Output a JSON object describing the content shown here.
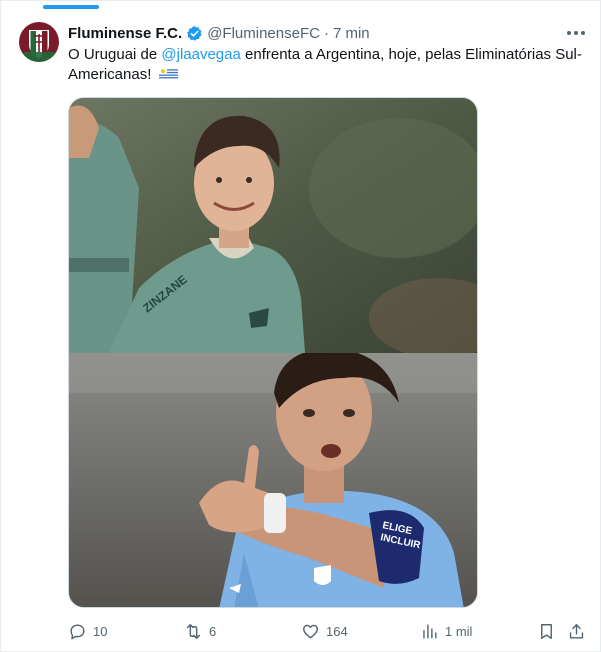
{
  "tweet": {
    "author_name": "Fluminense F.C.",
    "author_handle": "@FluminenseFC",
    "separator": "·",
    "time": "7 min",
    "text_before": "O Uruguai de ",
    "mention": "@jlaavegaa",
    "text_after": " enfrenta a Argentina, hoje, pelas Eliminatórias Sul-Americanas!",
    "emoji": "uruguay-flag"
  },
  "media": {
    "top_photo_text": "ZINZANE",
    "bottom_photo_text_1": "ELIGE",
    "bottom_photo_text_2": "INCLUIR"
  },
  "actions": {
    "replies": "10",
    "reposts": "6",
    "likes": "164",
    "views": "1 mil"
  },
  "colors": {
    "accent": "#1d9bf0",
    "secondary_text": "#536471",
    "primary_text": "#0f1419"
  }
}
